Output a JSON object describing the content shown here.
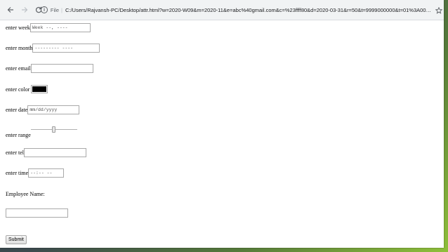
{
  "browser": {
    "scheme": "File",
    "url": "C:/Users/Rajvansh-PC/Desktop/attr.html?w=2020-W09&m=2020-11&e=abc%40gmail.com&c=%23ffff80&d=2020-03-31&r=50&t=9999000000&t=01%3A00&e1=..."
  },
  "form": {
    "week": {
      "label": "enter week",
      "value": "Week --, ----"
    },
    "month": {
      "label": "enter month",
      "value": "--------- ----"
    },
    "email": {
      "label": "enter email",
      "value": ""
    },
    "color": {
      "label": "enter color",
      "value": "#000000"
    },
    "date": {
      "label": "enter date",
      "value": "mm/dd/yyyy"
    },
    "range": {
      "label": "enter range",
      "value": 50,
      "min": 0,
      "max": 100
    },
    "tel": {
      "label": "enter tel",
      "value": ""
    },
    "time": {
      "label": "enter time",
      "value": "--:-- --"
    },
    "employee": {
      "label": "Employee Name:",
      "value": ""
    },
    "submit_label": "Submit"
  },
  "colors": {
    "toolbar_bg": "#f1f3f4",
    "page_bg": "#ffffff",
    "input_border": "#a9a9a9"
  }
}
